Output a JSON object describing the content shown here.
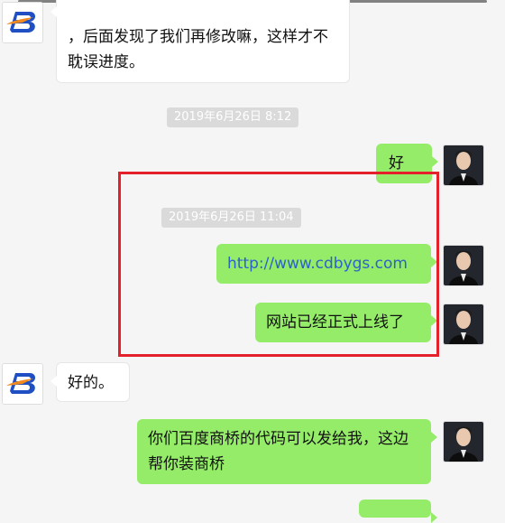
{
  "messages": {
    "first_left": "，后面发现了我们再修改嘛，这样才不耽误进度。",
    "ts1": "2019年6月26日 8:12",
    "ok": "好",
    "ts2": "2019年6月26日 11:04",
    "url": "http://www.cdbygs.com",
    "online": "网站已经正式上线了",
    "ok_reply": "好的。",
    "request": "你们百度商桥的代码可以发给我，这边帮你装商桥"
  },
  "icons": {
    "left_avatar": "logo-b-icon",
    "right_avatar": "user-photo-icon"
  },
  "colors": {
    "right_bubble": "#95ec69",
    "left_bubble": "#ffffff",
    "link": "#2b63c6",
    "highlight": "#e4202a",
    "timestamp_bg": "#dadada"
  }
}
